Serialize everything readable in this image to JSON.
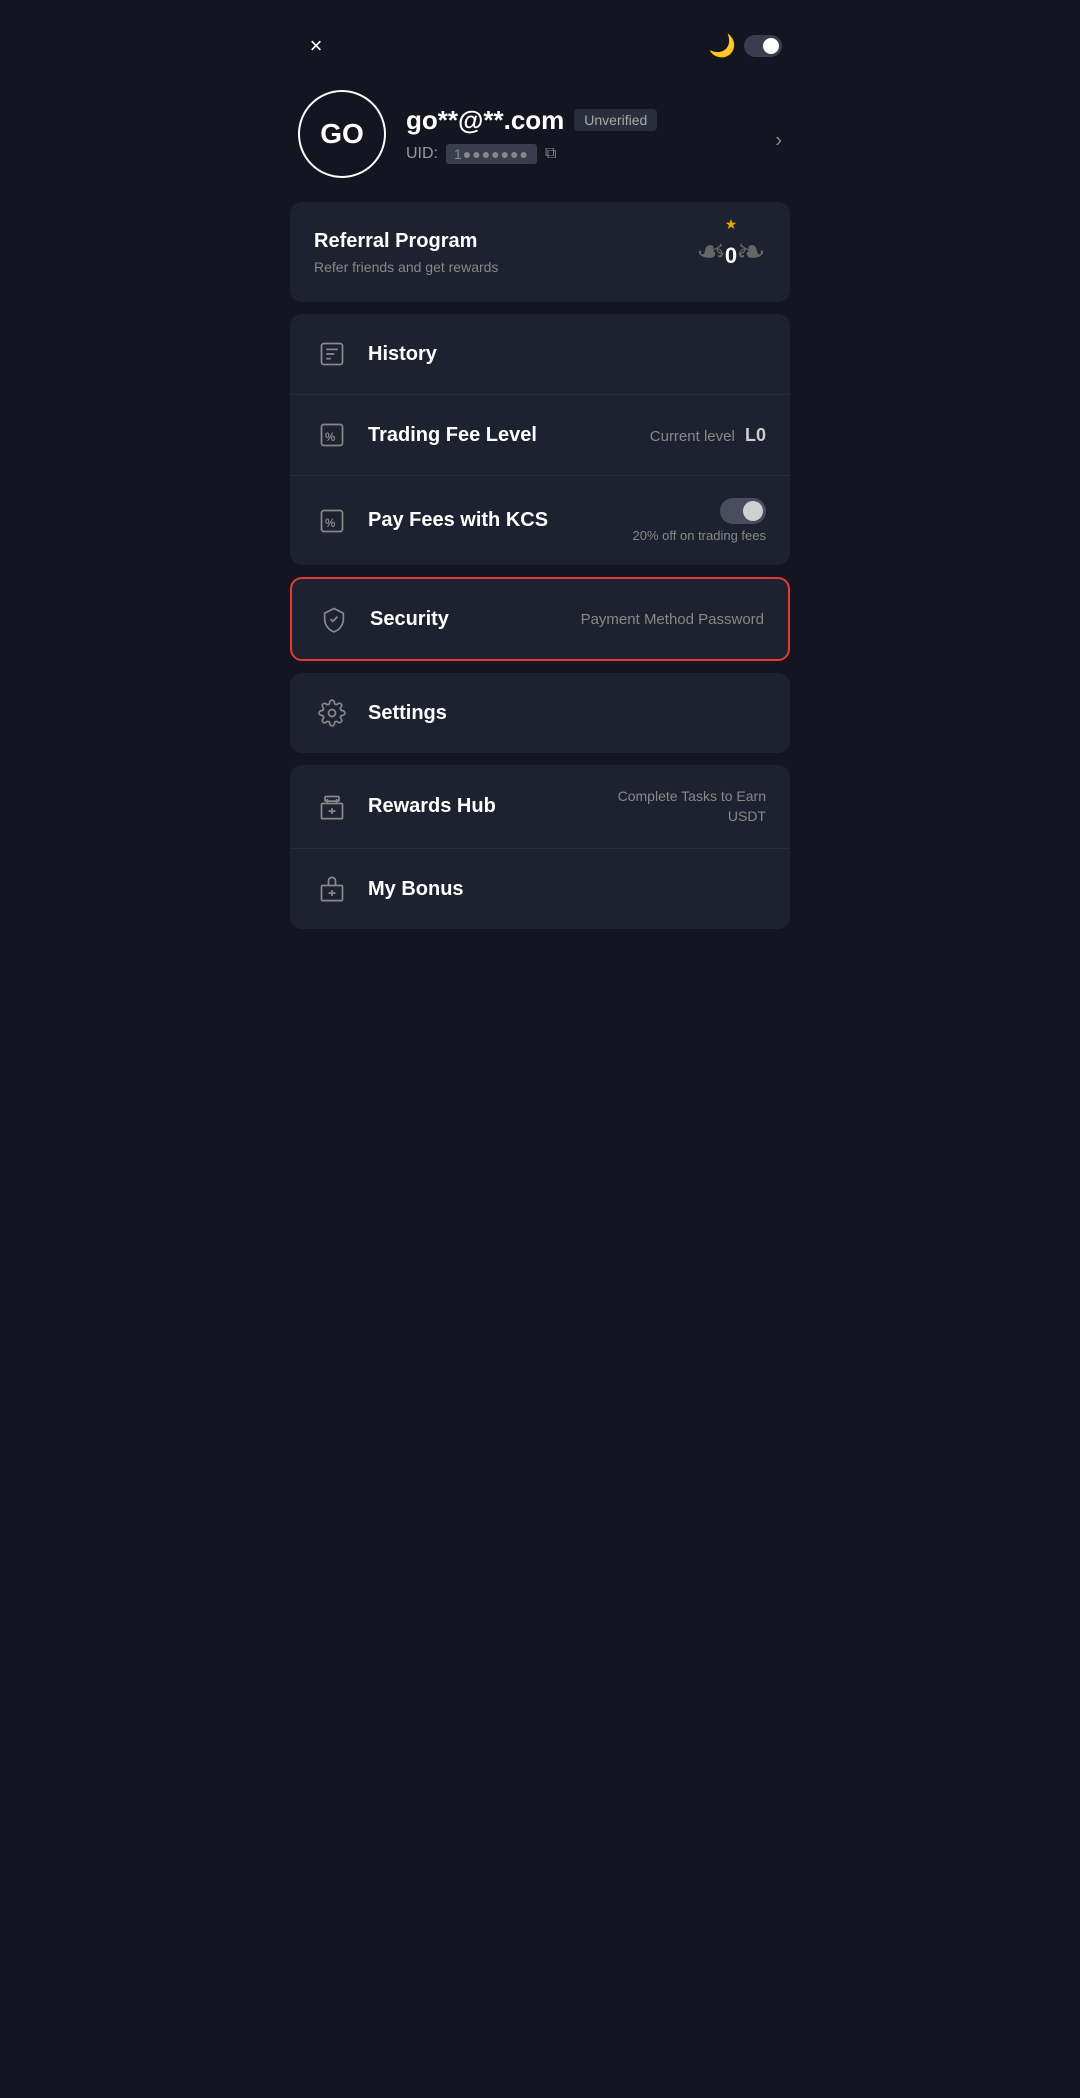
{
  "topbar": {
    "close_label": "×",
    "moon_icon": "🌙"
  },
  "profile": {
    "avatar_initials": "GO",
    "email": "go**@**.com",
    "verified_status": "Unverified",
    "uid_label": "UID:",
    "uid_value": "1●●●●●●●",
    "arrow": "›"
  },
  "referral": {
    "title": "Referral Program",
    "subtitle": "Refer friends and get rewards",
    "count": "0",
    "star": "★"
  },
  "history": {
    "label": "History"
  },
  "trading_fee": {
    "label": "Trading Fee Level",
    "value_prefix": "Current level",
    "value": "L0"
  },
  "kcs_fee": {
    "label": "Pay Fees with KCS",
    "discount": "20% off on trading fees"
  },
  "security": {
    "label": "Security",
    "value": "Payment Method Password"
  },
  "settings": {
    "label": "Settings"
  },
  "rewards_hub": {
    "label": "Rewards Hub",
    "value_line1": "Complete Tasks to Earn",
    "value_line2": "USDT"
  },
  "my_bonus": {
    "label": "My Bonus"
  }
}
